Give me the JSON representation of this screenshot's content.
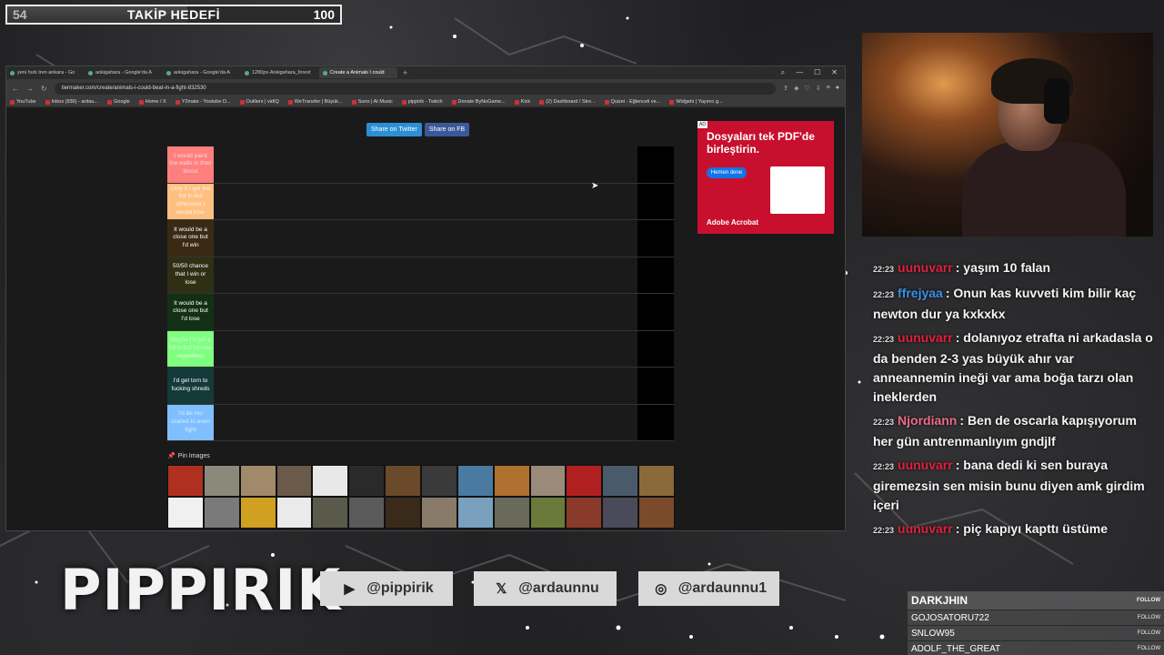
{
  "goal": {
    "current": "54",
    "title": "TAKİP HEDEFİ",
    "max": "100",
    "progress": 0.54
  },
  "browser": {
    "tabs": [
      {
        "label": "yeni hızlı tren ankara - Go",
        "active": false
      },
      {
        "label": "aokigahara - Google'da A",
        "active": false
      },
      {
        "label": "aokigahara - Google'da A",
        "active": false
      },
      {
        "label": "1280px-Aokigahara_forest",
        "active": false
      },
      {
        "label": "Create a Animals I could",
        "active": true
      }
    ],
    "url": "tiermaker.com/create/animals-i-could-beat-in-a-fight-832530",
    "bookmarks": [
      "YouTube",
      "Inbox (936) - ardau...",
      "Google",
      "Home / X",
      "Y2mate - Youtube D...",
      "Outliers | vidIQ",
      "WeTransfer | Büyük...",
      "Suno | AI Music",
      "pippirik - Twitch",
      "Donate ByNoGame...",
      "Kick",
      "(2) Dashboard / Stre...",
      "Quizei - Eğlenceli ve...",
      "Widgets | Yayıncı g..."
    ]
  },
  "tierlist": {
    "share_twitter": "Share on Twitter",
    "share_fb": "Share on FB",
    "tiers": [
      {
        "label": "I would paint the walls in their blood",
        "color": "#ff7f7f",
        "text": "#ffd9d9"
      },
      {
        "label": "Only if I get the fist in but otherwise I would lose",
        "color": "#ffbf7f",
        "text": "#fff3e6"
      },
      {
        "label": "It would be a close one but I'd win",
        "color": "#3a2a14",
        "text": "#ffffff"
      },
      {
        "label": "50/50 chance that I win or lose",
        "color": "#2f2f14",
        "text": "#ffffff"
      },
      {
        "label": "It would be a close one but I'd lose",
        "color": "#143014",
        "text": "#ffffff"
      },
      {
        "label": "Maybe I'd get a hit in but I'd lose regardless",
        "color": "#7fff7f",
        "text": "#d9ffd9"
      },
      {
        "label": "I'd get torn to fucking shreds",
        "color": "#143a3a",
        "text": "#ffffff"
      },
      {
        "label": "I'd be too scared to even fight",
        "color": "#7fbfff",
        "text": "#d9ecff"
      }
    ],
    "pin_label": "Pin Images",
    "image_colors": [
      "#b03020",
      "#8a8a7a",
      "#a08a6a",
      "#6a5a4a",
      "#e8e8e8",
      "#2a2a2a",
      "#6a4a2a",
      "#3a3a3a",
      "#4a7aa0",
      "#b07030",
      "#9a8a7a",
      "#b02020",
      "#4a5a6a",
      "#8a6a3a",
      "#f0f0f0",
      "#7a7a7a",
      "#d0a020",
      "#eaeaea",
      "#5a5a4a",
      "#5a5a5a",
      "#3a2a1a",
      "#8a7a6a",
      "#7aa0c0",
      "#6a6a5a",
      "#6a7a3a",
      "#8a3a2a",
      "#4a4a5a",
      "#7a4a2a"
    ]
  },
  "ad": {
    "tag": "AD",
    "headline": "Dosyaları tek PDF'de birleştirin.",
    "button": "Hemen dene",
    "brand": "Adobe Acrobat"
  },
  "chat": [
    {
      "time": "22:23",
      "user": "uunuvarr",
      "color": "#e0213c",
      "text": "yaşım 10 falan"
    },
    {
      "time": "22:23",
      "user": "ffrejyaa",
      "color": "#3b8fe6",
      "text": "Onun kas kuvveti kim bilir kaç newton dur ya kxkxkx"
    },
    {
      "time": "22:23",
      "user": "uunuvarr",
      "color": "#e0213c",
      "text": "dolanıyoz etrafta ni arkadasla o da benden 2-3 yas büyük ahır var anneannemin ineği var ama boğa tarzı olan ineklerden"
    },
    {
      "time": "22:23",
      "user": "Njordiann",
      "color": "#f06a8a",
      "text": "Ben de oscarla kapışıyorum her gün antrenmanlıyım gndjlf"
    },
    {
      "time": "22:23",
      "user": "uunuvarr",
      "color": "#e0213c",
      "text": "bana dedi ki sen buraya giremezsin sen misin bunu diyen amk girdim içeri"
    },
    {
      "time": "22:23",
      "user": "uunuvarr",
      "color": "#e0213c",
      "text": "piç kapıyı kapttı üstüme"
    }
  ],
  "logo": "PIPPIRIK",
  "socials": [
    {
      "icon": "youtube-icon",
      "handle": "@pippirik"
    },
    {
      "icon": "x-icon",
      "handle": "@ardaunnu"
    },
    {
      "icon": "instagram-icon",
      "handle": "@ardaunnu1"
    }
  ],
  "follows": {
    "label": "FOLLOW",
    "names": [
      "DARKJHIN",
      "GOJOSATORU722",
      "SNLOW95",
      "ADOLF_THE_GREAT"
    ]
  }
}
